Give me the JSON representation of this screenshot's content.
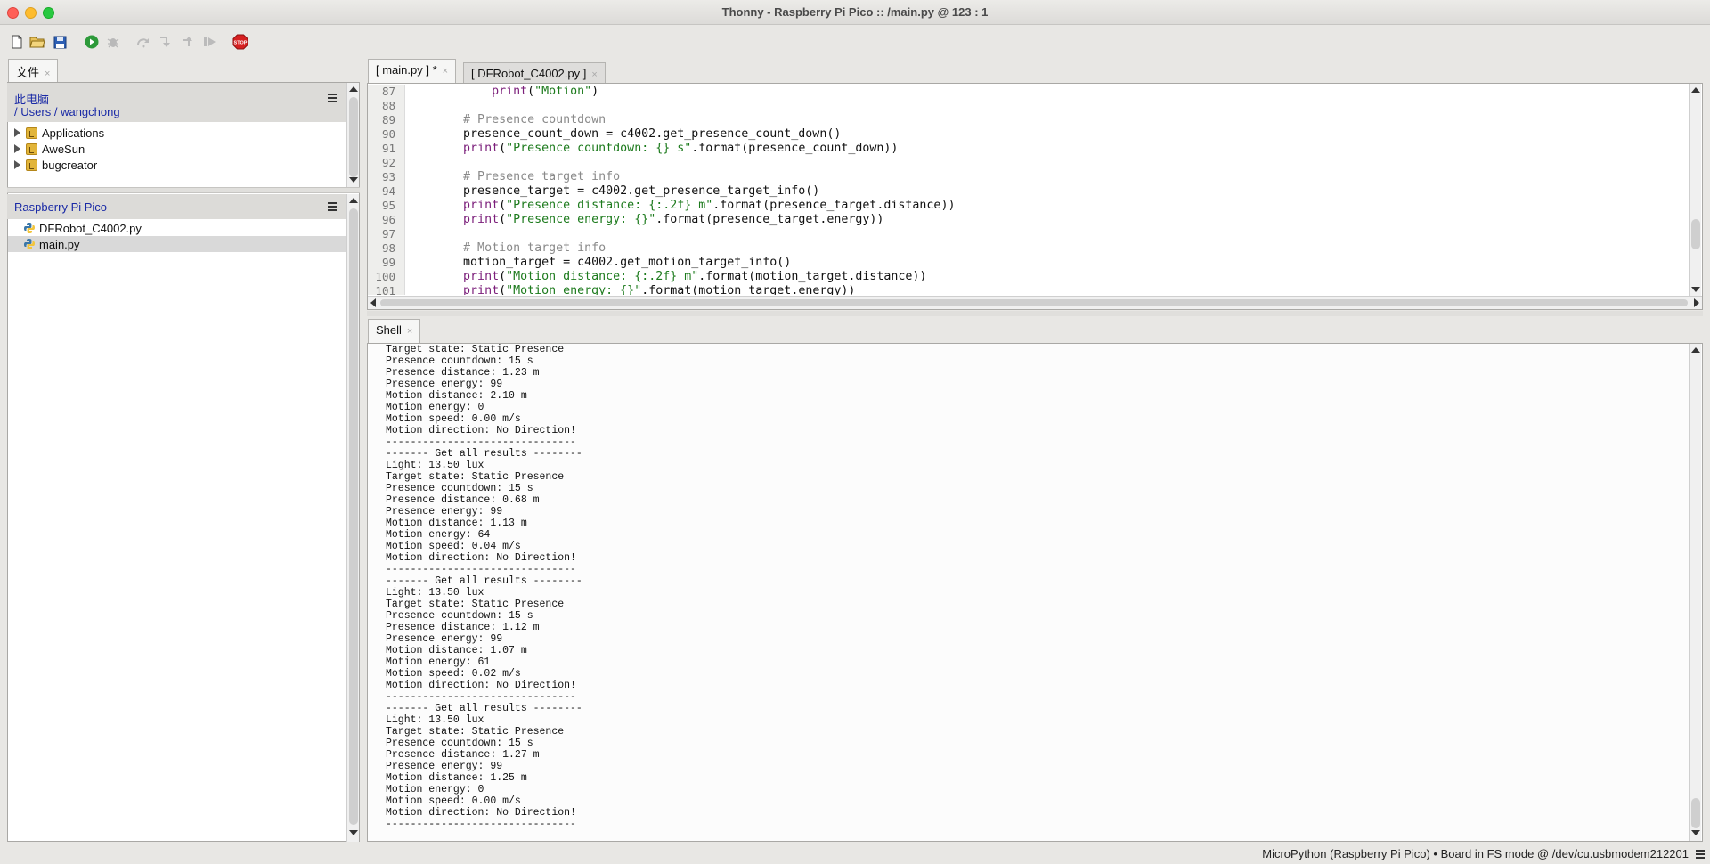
{
  "window": {
    "title": "Thonny  -  Raspberry Pi Pico :: /main.py  @  123 : 1"
  },
  "toolbar": {
    "buttons": [
      "new-file-icon",
      "open-file-icon",
      "save-icon",
      "run-icon",
      "debug-icon",
      "step-over-icon",
      "step-into-icon",
      "step-out-icon",
      "resume-icon",
      "stop-icon"
    ],
    "stop_label": "STOP"
  },
  "files_panel": {
    "tab_label": "文件",
    "tab_close": "×",
    "computer": {
      "label": "此电脑",
      "path_sep": "/",
      "path_users": "Users",
      "path_user": "wangchong",
      "items": [
        {
          "label": "Applications"
        },
        {
          "label": "AweSun"
        },
        {
          "label": "bugcreator"
        }
      ]
    },
    "device": {
      "label": "Raspberry Pi Pico",
      "items": [
        {
          "label": "DFRobot_C4002.py"
        },
        {
          "label": "main.py",
          "selected": true
        }
      ]
    }
  },
  "editor": {
    "tabs": [
      {
        "label": "[ main.py ] *",
        "close": "×",
        "active": true
      },
      {
        "label": "[ DFRobot_C4002.py ]",
        "close": "×",
        "active": false
      }
    ],
    "line_numbers": [
      "87",
      "88",
      "89",
      "90",
      "91",
      "92",
      "93",
      "94",
      "95",
      "96",
      "97",
      "98",
      "99",
      "100",
      "101"
    ],
    "lines": [
      [
        {
          "t": "            "
        },
        {
          "t": "print",
          "c": "kw"
        },
        {
          "t": "("
        },
        {
          "t": "\"Motion\"",
          "c": "str"
        },
        {
          "t": ")"
        }
      ],
      [],
      [
        {
          "t": "        "
        },
        {
          "t": "# Presence countdown",
          "c": "cmt"
        }
      ],
      [
        {
          "t": "        presence_count_down = c4002.get_presence_count_down()"
        }
      ],
      [
        {
          "t": "        "
        },
        {
          "t": "print",
          "c": "kw"
        },
        {
          "t": "("
        },
        {
          "t": "\"Presence countdown: {} s\"",
          "c": "str"
        },
        {
          "t": ".format(presence_count_down))"
        }
      ],
      [],
      [
        {
          "t": "        "
        },
        {
          "t": "# Presence target info",
          "c": "cmt"
        }
      ],
      [
        {
          "t": "        presence_target = c4002.get_presence_target_info()"
        }
      ],
      [
        {
          "t": "        "
        },
        {
          "t": "print",
          "c": "kw"
        },
        {
          "t": "("
        },
        {
          "t": "\"Presence distance: {:.2f} m\"",
          "c": "str"
        },
        {
          "t": ".format(presence_target.distance))"
        }
      ],
      [
        {
          "t": "        "
        },
        {
          "t": "print",
          "c": "kw"
        },
        {
          "t": "("
        },
        {
          "t": "\"Presence energy: {}\"",
          "c": "str"
        },
        {
          "t": ".format(presence_target.energy))"
        }
      ],
      [],
      [
        {
          "t": "        "
        },
        {
          "t": "# Motion target info",
          "c": "cmt"
        }
      ],
      [
        {
          "t": "        motion_target = c4002.get_motion_target_info()"
        }
      ],
      [
        {
          "t": "        "
        },
        {
          "t": "print",
          "c": "kw"
        },
        {
          "t": "("
        },
        {
          "t": "\"Motion distance: {:.2f} m\"",
          "c": "str"
        },
        {
          "t": ".format(motion_target.distance))"
        }
      ],
      [
        {
          "t": "        "
        },
        {
          "t": "print",
          "c": "kw"
        },
        {
          "t": "("
        },
        {
          "t": "\"Motion energy: {}\"",
          "c": "str"
        },
        {
          "t": ".format(motion_target.energy))"
        }
      ]
    ]
  },
  "shell": {
    "tab_label": "Shell",
    "tab_close": "×",
    "lines": [
      "Target state: Static Presence",
      "Presence countdown: 15 s",
      "Presence distance: 1.23 m",
      "Presence energy: 99",
      "Motion distance: 2.10 m",
      "Motion energy: 0",
      "Motion speed: 0.00 m/s",
      "Motion direction: No Direction!",
      "-------------------------------",
      "------- Get all results --------",
      "Light: 13.50 lux",
      "Target state: Static Presence",
      "Presence countdown: 15 s",
      "Presence distance: 0.68 m",
      "Presence energy: 99",
      "Motion distance: 1.13 m",
      "Motion energy: 64",
      "Motion speed: 0.04 m/s",
      "Motion direction: No Direction!",
      "-------------------------------",
      "------- Get all results --------",
      "Light: 13.50 lux",
      "Target state: Static Presence",
      "Presence countdown: 15 s",
      "Presence distance: 1.12 m",
      "Presence energy: 99",
      "Motion distance: 1.07 m",
      "Motion energy: 61",
      "Motion speed: 0.02 m/s",
      "Motion direction: No Direction!",
      "-------------------------------",
      "------- Get all results --------",
      "Light: 13.50 lux",
      "Target state: Static Presence",
      "Presence countdown: 15 s",
      "Presence distance: 1.27 m",
      "Presence energy: 99",
      "Motion distance: 1.25 m",
      "Motion energy: 0",
      "Motion speed: 0.00 m/s",
      "Motion direction: No Direction!",
      "-------------------------------"
    ]
  },
  "statusbar": {
    "text": "MicroPython (Raspberry Pi Pico)  •  Board in FS mode @ /dev/cu.usbmodem212201"
  },
  "colors": {
    "keyword": "#7b1e7a",
    "string": "#1c7a1c",
    "comment": "#8a8a8a",
    "link": "#1a2aa6",
    "stop": "#d62020"
  }
}
